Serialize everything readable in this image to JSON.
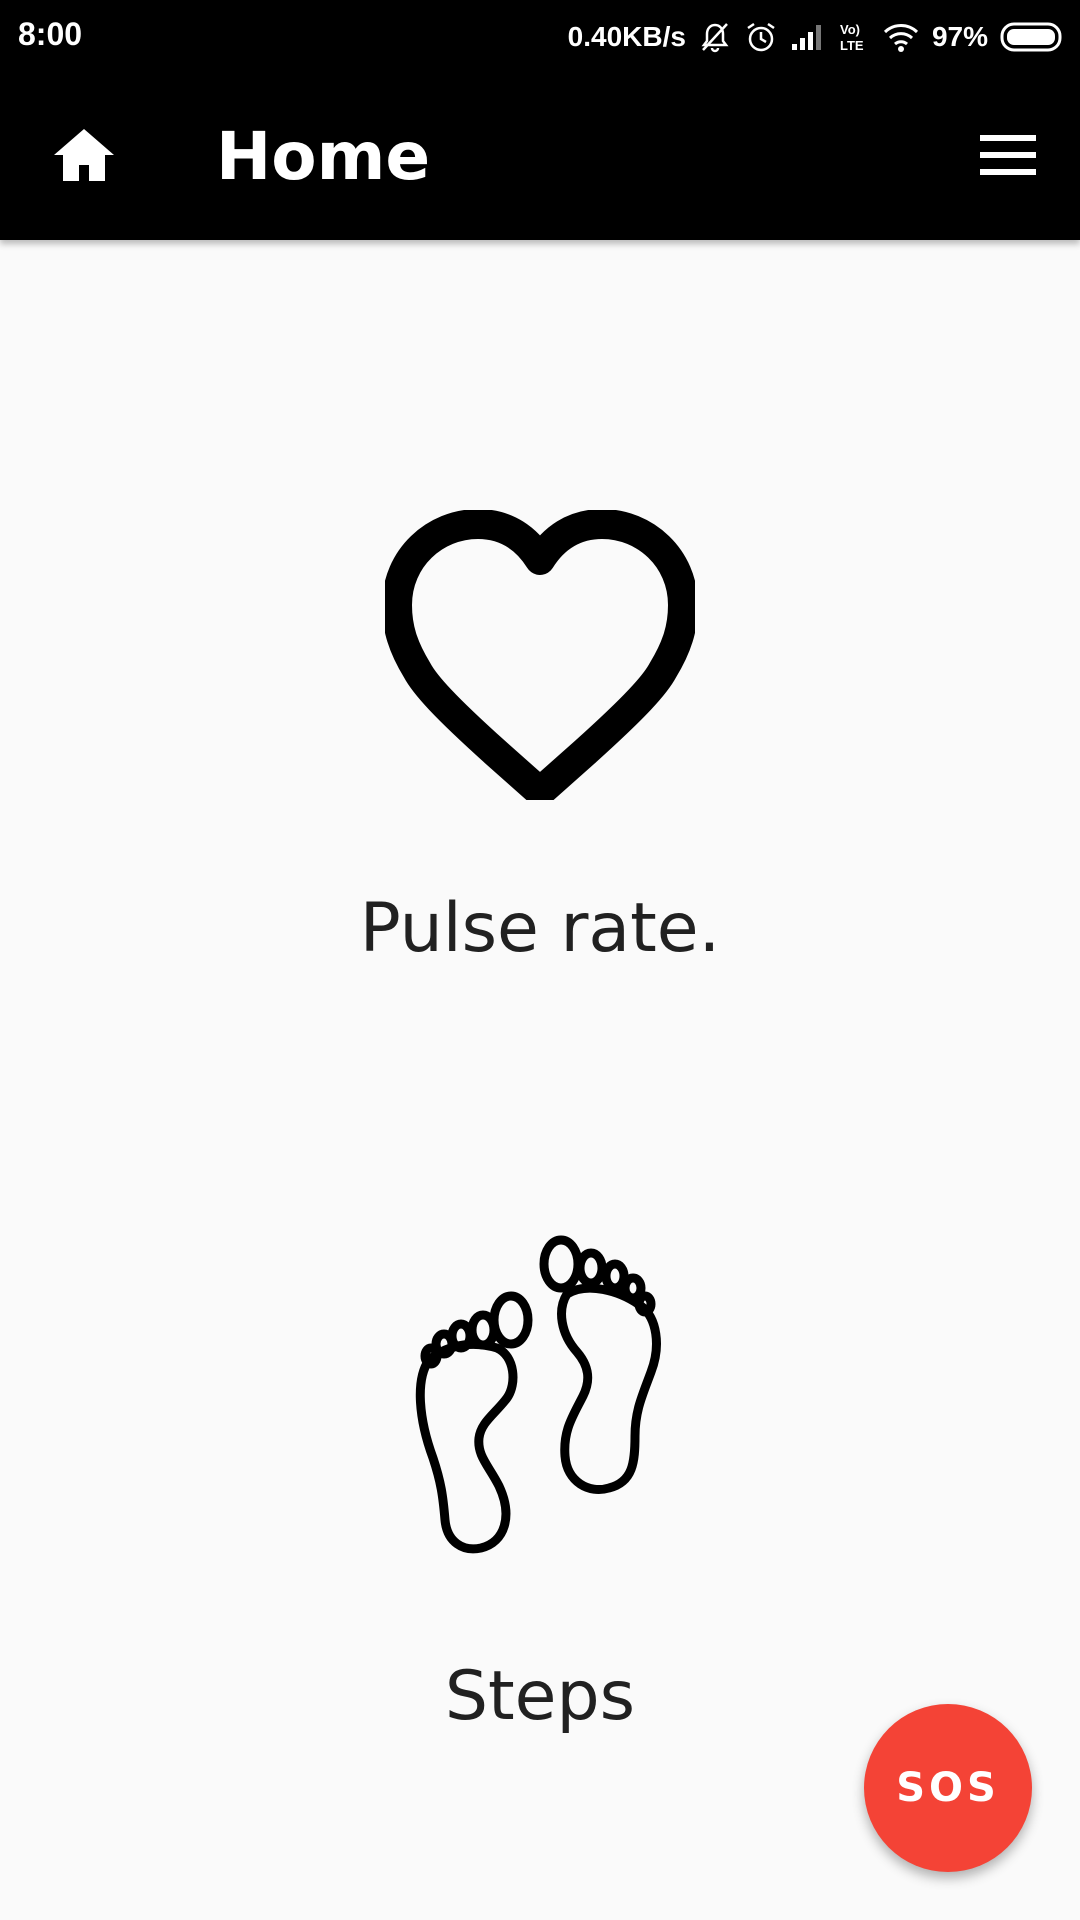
{
  "status_bar": {
    "time": "8:00",
    "network_speed": "0.40KB/s",
    "battery_percent": "97%",
    "icons": [
      "mute-icon",
      "alarm-icon",
      "signal-icon",
      "volte-icon",
      "wifi-icon",
      "battery-icon"
    ]
  },
  "app_bar": {
    "title": "Home",
    "left_icon": "home-icon",
    "right_icon": "menu-icon"
  },
  "cards": {
    "pulse": {
      "label": "Pulse rate.",
      "icon": "heart-icon"
    },
    "steps": {
      "label": "Steps",
      "icon": "footprints-icon"
    }
  },
  "fab": {
    "label": "SOS",
    "color": "#f44336"
  },
  "colors": {
    "app_bar": "#000000",
    "background": "#fafafa",
    "text": "#212121"
  }
}
